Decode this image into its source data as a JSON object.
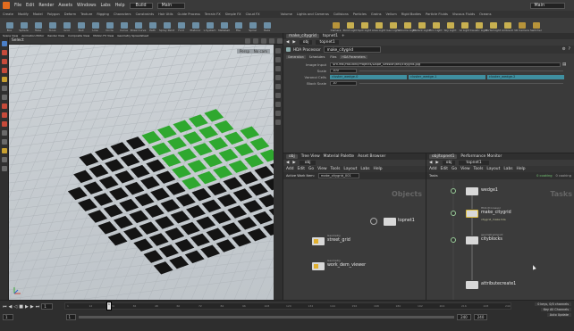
{
  "menu": {
    "items": [
      "File",
      "Edit",
      "Render",
      "Assets",
      "Windows",
      "Labs",
      "Help"
    ],
    "build": "Build",
    "desktop": "Main",
    "right_desktop": "Main"
  },
  "shelf_tabs": [
    "Create",
    "Modify",
    "Model",
    "Polygon",
    "Deform",
    "Texture",
    "Rigging",
    "Characters",
    "Constraints",
    "Hair Utils",
    "Guide Process",
    "Terrain FX",
    "Simple FX",
    "Cloud FX",
    "Volume",
    "Lights and Cameras",
    "Collisions",
    "Particles",
    "Grains",
    "Vellum",
    "Rigid Bodies",
    "Particle Fluids",
    "Viscous Fluids",
    "Oceans",
    "Fluid Containers",
    "Populate Containers",
    "Container Tools",
    "Pyro FX",
    "FEM",
    "Wires",
    "Crowds",
    "Drive Simulation"
  ],
  "shelf_tools": [
    "Box",
    "Sphere",
    "Tube",
    "Torus",
    "Grid",
    "Null",
    "Line",
    "Circle",
    "Curve",
    "Draw Curve",
    "Path",
    "Spray Paint",
    "Font",
    "Platonic",
    "L-System",
    "Metaball",
    "File",
    "Spiral",
    "Helix"
  ],
  "light_tools": [
    "Camera",
    "Point Light",
    "Spot Light",
    "Area Light",
    "Geo Light",
    "Volume Light",
    "Distant Light",
    "Env Light",
    "Sky Light",
    "GI Light",
    "Caustic Light",
    "Portal Light",
    "Ambient",
    "VR Camera",
    "Switcher"
  ],
  "pane_tabs_left": [
    "Scene View",
    "Animation Editor",
    "Render View",
    "Composite View",
    "Motion FX View",
    "Geometry Spreadsheet"
  ],
  "viewport": {
    "path": "obj",
    "tool": "Select",
    "persp": "Persp",
    "cam": "No cam"
  },
  "parm_pane": {
    "tab": "make_citygrid",
    "path": "topnet1",
    "node_type": "HDA Processor",
    "node_name": "make_citygrid",
    "tabs": [
      "Generation",
      "Schedulers",
      "Files",
      "HDA Parameters"
    ],
    "parms": [
      {
        "label": "Image Input",
        "value": "$HOME/Houdini/Projects/Dope_Session/tex/citygrid.jpg"
      },
      {
        "label": "Scale",
        "value": "100"
      },
      {
        "label": "Voronoi Cells",
        "values": [
          "cluster_wedge.0",
          "cluster_wedge.1",
          "cluster_wedge.2"
        ]
      },
      {
        "label": "Block Scale",
        "value": "10"
      }
    ]
  },
  "net_left": {
    "tabs": [
      "obj",
      "Tree View",
      "Material Palette",
      "Asset Browser"
    ],
    "path": "obj",
    "menus": [
      "Add",
      "Edit",
      "Go",
      "View",
      "Tools",
      "Layout",
      "Labs",
      "Help"
    ],
    "work_item": "Active Work Item:",
    "work_item_value": "make_citygrid_001",
    "context": "Objects",
    "nodes": [
      {
        "name": "topnet1"
      },
      {
        "name": "street_grid",
        "sub": "Geometry"
      },
      {
        "name": "work_dem_viewer",
        "sub": "Geometry"
      }
    ]
  },
  "net_right": {
    "tabs": [
      "obj/topnet1",
      "Performance Monitor"
    ],
    "path": "obj",
    "path2": "topnet1",
    "menus": [
      "Add",
      "Edit",
      "Go",
      "View",
      "Tools",
      "Layout",
      "Labs",
      "Help"
    ],
    "tasks": "Tasks",
    "cooking": "0 cooking",
    "dots": "0 cooking",
    "tasks_label": "Tasks",
    "nodes": [
      {
        "name": "wedge1"
      },
      {
        "name": "make_citygrid",
        "sub": "HDA Processor",
        "note": "citygrid_make.hda"
      },
      {
        "name": "cityblocks",
        "sub": "geometryimport"
      },
      {
        "name": "attributecreate1"
      }
    ]
  },
  "timeline": {
    "frame": "1",
    "start": "1",
    "end": "240",
    "end2": "240",
    "keys": "0 keys, 0/0 channels",
    "key_all": "Key All Channels",
    "auto_update": "Auto Update"
  },
  "ticks": [
    "1",
    "12",
    "24",
    "36",
    "48",
    "60",
    "72",
    "84",
    "96",
    "108",
    "120",
    "132",
    "144",
    "156",
    "168",
    "180",
    "192",
    "204",
    "216",
    "228",
    "240"
  ],
  "colors": {
    "accent": "#e36c1f",
    "green_blocks": "#2fa82f",
    "teal": "#3f8fa0"
  }
}
